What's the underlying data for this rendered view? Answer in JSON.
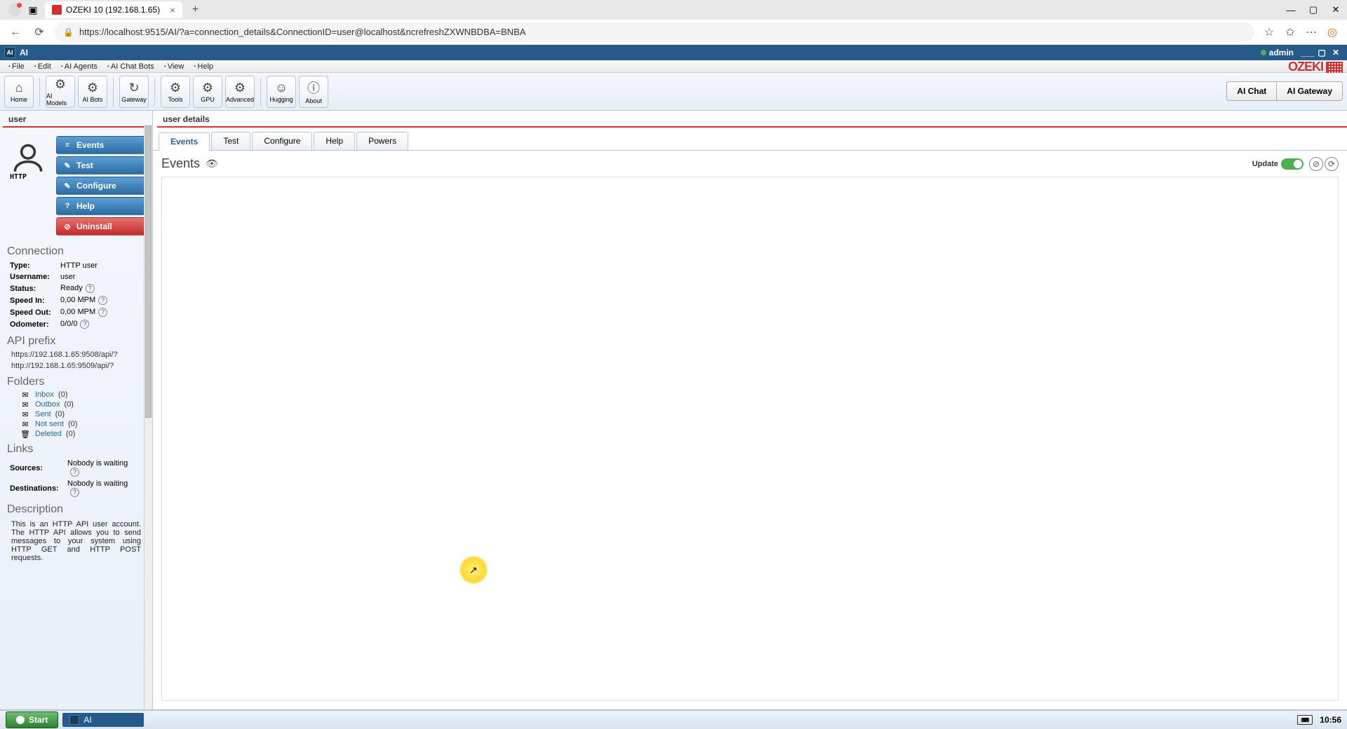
{
  "browser": {
    "tab_title": "OZEKI 10 (192.168.1.65)",
    "url_display": "https://localhost:9515/AI/?a=connection_details&ConnectionID=user@localhost&ncrefreshZXWNBDBA=BNBA",
    "url_host": "localhost"
  },
  "app_titlebar": {
    "title": "AI",
    "user": "admin"
  },
  "menubar": [
    "File",
    "Edit",
    "AI Agents",
    "AI Chat Bots",
    "View",
    "Help"
  ],
  "brand": {
    "name": "OZEKI",
    "url": "www.myozeki.com"
  },
  "toolbar": [
    {
      "label": "Home",
      "icon": "home",
      "sep_after": true
    },
    {
      "label": "AI Models",
      "icon": "gear"
    },
    {
      "label": "AI Bots",
      "icon": "gear",
      "sep_after": true
    },
    {
      "label": "Gateway",
      "icon": "gateway",
      "sep_after": true
    },
    {
      "label": "Tools",
      "icon": "gear"
    },
    {
      "label": "GPU",
      "icon": "gear"
    },
    {
      "label": "Advanced",
      "icon": "gear",
      "sep_after": true
    },
    {
      "label": "Hugging",
      "icon": "hf"
    },
    {
      "label": "About",
      "icon": "info"
    }
  ],
  "segments": {
    "left": "AI Chat",
    "right": "AI Gateway"
  },
  "sidebar": {
    "title": "user",
    "avatar_proto": "HTTP",
    "actions": [
      {
        "label": "Events",
        "icon": "≡",
        "style": "blue"
      },
      {
        "label": "Test",
        "icon": "✎",
        "style": "blue"
      },
      {
        "label": "Configure",
        "icon": "✎",
        "style": "blue"
      },
      {
        "label": "Help",
        "icon": "?",
        "style": "blue"
      },
      {
        "label": "Uninstall",
        "icon": "⊘",
        "style": "red"
      }
    ],
    "connection_title": "Connection",
    "connection": [
      {
        "k": "Type:",
        "v": "HTTP user",
        "q": false
      },
      {
        "k": "Username:",
        "v": "user",
        "q": false,
        "underline": true
      },
      {
        "k": "Status:",
        "v": "Ready",
        "q": true
      },
      {
        "k": "Speed In:",
        "v": "0,00 MPM",
        "q": true
      },
      {
        "k": "Speed Out:",
        "v": "0,00 MPM",
        "q": true
      },
      {
        "k": "Odometer:",
        "v": "0/0/0",
        "q": true
      }
    ],
    "api_prefix_title": "API prefix",
    "api_prefix": [
      "https://192.168.1.65:9508/api/?",
      "http://192.168.1.65:9509/api/?"
    ],
    "folders_title": "Folders",
    "folders": [
      {
        "name": "Inbox",
        "count": "(0)",
        "icon": "📥"
      },
      {
        "name": "Outbox",
        "count": "(0)",
        "icon": "📤"
      },
      {
        "name": "Sent",
        "count": "(0)",
        "icon": "📨"
      },
      {
        "name": "Not sent",
        "count": "(0)",
        "icon": "📭"
      },
      {
        "name": "Deleted",
        "count": "(0)",
        "icon": "🗑"
      }
    ],
    "links_title": "Links",
    "links": [
      {
        "k": "Sources:",
        "v": "Nobody is waiting",
        "q": true
      },
      {
        "k": "Destinations:",
        "v": "Nobody is waiting",
        "q": true
      }
    ],
    "desc_title": "Description",
    "description": "This is an HTTP API user account. The HTTP API allows you to send messages to your system using HTTP GET and HTTP POST requests."
  },
  "main": {
    "title": "user details",
    "tabs": [
      "Events",
      "Test",
      "Configure",
      "Help",
      "Powers"
    ],
    "active_tab": "Events",
    "events_heading": "Events",
    "update_label": "Update"
  },
  "taskbar": {
    "start": "Start",
    "item": "AI",
    "clock": "10:56"
  }
}
